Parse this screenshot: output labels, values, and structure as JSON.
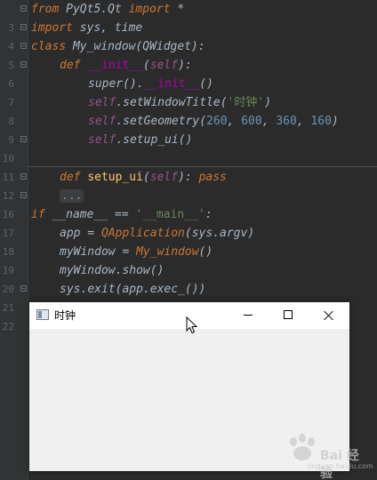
{
  "editor": {
    "lines": [
      {
        "num": "3",
        "tokens": [
          "from",
          " PyQt5.Qt ",
          "import",
          " *"
        ]
      },
      {
        "num": "4",
        "tokens": [
          "import",
          " sys, time"
        ]
      },
      {
        "num": "5",
        "tokens": [
          "class",
          " ",
          "My_window",
          "(QWidget):"
        ]
      },
      {
        "num": "6",
        "tokens": [
          "def",
          " ",
          "__init__",
          "(",
          "self",
          "):"
        ]
      },
      {
        "num": "7",
        "tokens": [
          "super",
          "().",
          "__init__",
          "()"
        ]
      },
      {
        "num": "8",
        "tokens": [
          "self",
          ".",
          "setWindowTitle",
          "(",
          "'时钟'",
          ")"
        ]
      },
      {
        "num": "9",
        "tokens": [
          "self",
          ".",
          "setGeometry",
          "(",
          "260",
          ", ",
          "600",
          ", ",
          "360",
          ", ",
          "160",
          ")"
        ]
      },
      {
        "num": "10",
        "tokens": [
          "self",
          ".",
          "setup_ui",
          "()"
        ]
      },
      {
        "num": "11",
        "tokens": []
      },
      {
        "num": "12",
        "tokens": [
          "def",
          " ",
          "setup_ui",
          "(",
          "self",
          "): ",
          "pass"
        ]
      },
      {
        "num": "16",
        "tokens": [
          "..."
        ]
      },
      {
        "num": "17",
        "tokens": [
          "if",
          " ",
          "__name__",
          " == ",
          "'__main__'",
          ":"
        ]
      },
      {
        "num": "18",
        "tokens": [
          "app = ",
          "QApplication",
          "(sys.argv)"
        ]
      },
      {
        "num": "19",
        "tokens": [
          "myWindow = ",
          "My_window",
          "()"
        ]
      },
      {
        "num": "20",
        "tokens": [
          "myWindow.",
          "show",
          "()"
        ]
      },
      {
        "num": "21",
        "tokens": [
          "sys.",
          "exit",
          "(app.",
          "exec_",
          "())"
        ]
      },
      {
        "num": "22",
        "tokens": []
      }
    ]
  },
  "qt_window": {
    "title": "时钟",
    "icon": "qt-app-icon",
    "minimize_icon": "minimize-icon",
    "maximize_icon": "maximize-icon",
    "close_icon": "close-icon"
  },
  "watermark": {
    "text": "Bai 经验",
    "sub": "jingyan.baidu.com"
  },
  "colors": {
    "background": "#2b2b2b",
    "gutter": "#313335",
    "keyword": "#cc7832",
    "function": "#ffc66d",
    "dunder": "#b200b2",
    "self": "#94558d",
    "string": "#6a8759",
    "number": "#6897bb",
    "text": "#a9b7c6"
  }
}
